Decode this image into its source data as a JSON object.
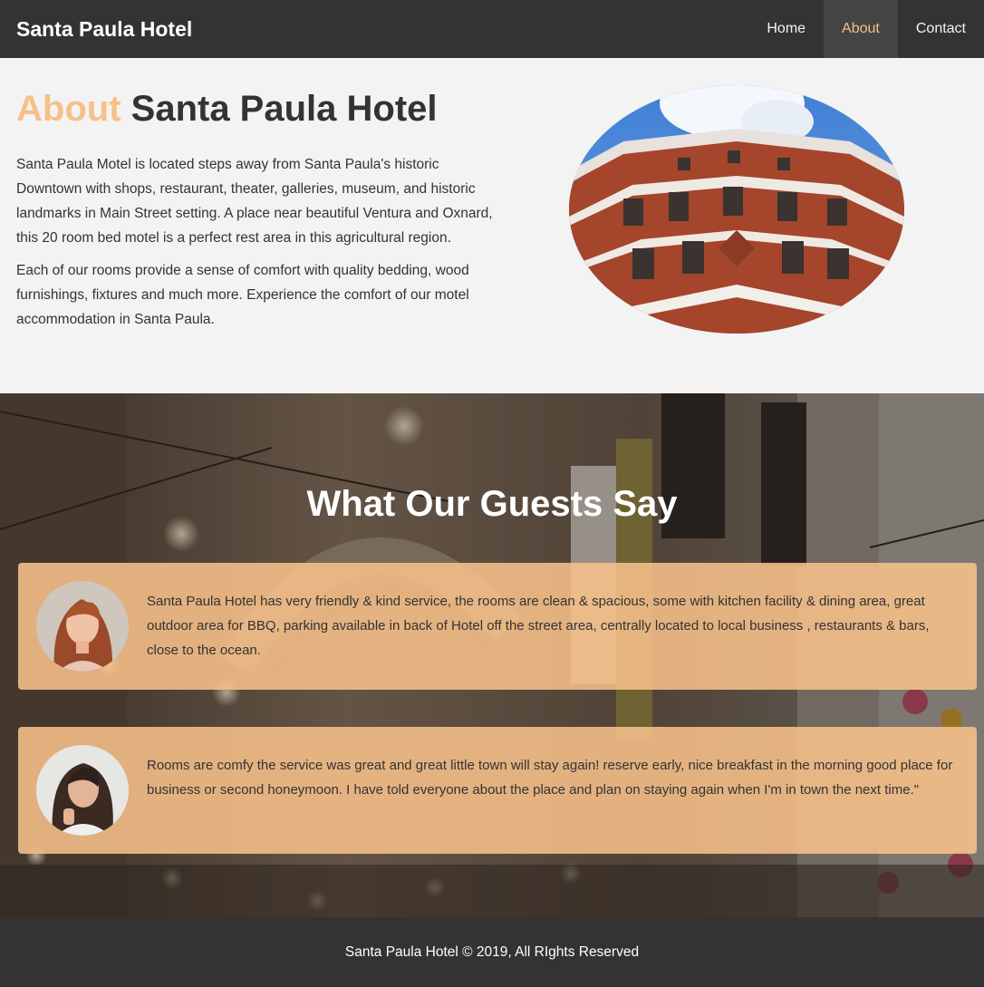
{
  "nav": {
    "brand": "Santa Paula Hotel",
    "links": [
      {
        "label": "Home"
      },
      {
        "label": "About"
      },
      {
        "label": "Contact"
      }
    ]
  },
  "about": {
    "title_accent": "About",
    "title_rest": "Santa Paula Hotel",
    "paragraphs": [
      "Santa Paula Motel is located steps away from Santa Paula's historic Downtown with shops, restaurant, theater, galleries, museum, and historic landmarks in Main Street setting. A place near beautiful Ventura and Oxnard, this 20 room bed motel is a perfect rest area in this agricultural region.",
      "Each of our rooms provide a sense of comfort with quality bedding, wood furnishings, fixtures and much more. Experience the comfort of our motel accommodation in Santa Paula."
    ]
  },
  "testimonials": {
    "title": "What Our Guests Say",
    "items": [
      {
        "text": "Santa Paula Hotel has very friendly & kind service, the rooms are clean & spacious, some with kitchen facility & dining area, great outdoor area for BBQ, parking available in back of Hotel off the street area, centrally located to local business , restaurants & bars, close to the ocean."
      },
      {
        "text": "Rooms are comfy the service was great and great little town will stay again! reserve early, nice breakfast in the morning good place for business or second honeymoon. I have told everyone about the place and plan on staying again when I'm in town the next time.\""
      }
    ]
  },
  "footer": {
    "text": "Santa Paula Hotel © 2019, All RIghts Reserved"
  },
  "colors": {
    "accent": "#f7c08a",
    "dark": "#333333",
    "nav_active_bg": "#444444",
    "light_bg": "#f3f3f3"
  }
}
